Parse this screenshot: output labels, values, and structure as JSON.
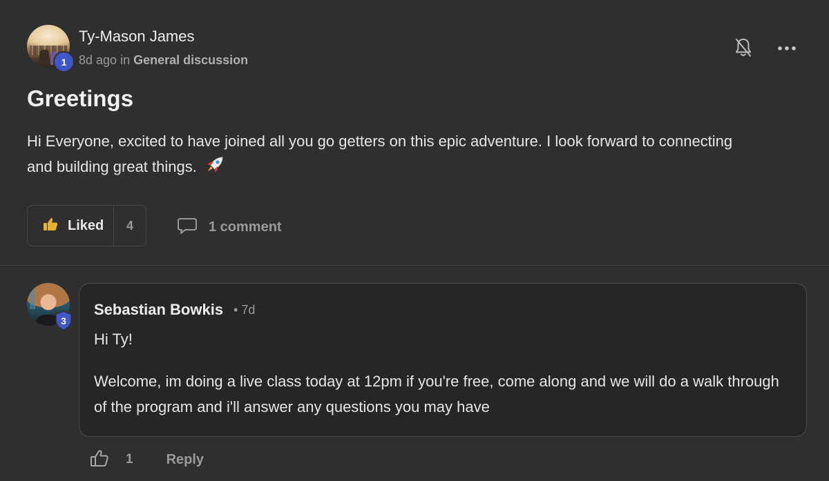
{
  "post": {
    "author": "Ty-Mason James",
    "author_level": "1",
    "time_ago": "8d ago",
    "in_word": "in",
    "category": "General discussion",
    "title": "Greetings",
    "body": "Hi Everyone, excited to have joined all you go getters on this epic adventure. I look forward to connecting and building great things.",
    "like_label": "Liked",
    "like_count": "4",
    "comment_label": "1 comment",
    "icons": {
      "notifications": "bell-off-icon",
      "more": "more-horizontal-icon",
      "like": "thumbs-up-icon",
      "comment": "comment-bubble-icon",
      "emoji": "rocket-icon"
    },
    "colors": {
      "level_badge": "#3f57c8",
      "liked_icon": "#e8b130"
    }
  },
  "comment": {
    "author": "Sebastian Bowkis",
    "author_level": "3",
    "time": "7d",
    "separator": "•",
    "greeting": "Hi Ty!",
    "body": "Welcome, im doing a live class today at 12pm if you're free, come along and we will do a walk through of the program and i'll answer any questions you may have",
    "like_count": "1",
    "reply_label": "Reply"
  }
}
